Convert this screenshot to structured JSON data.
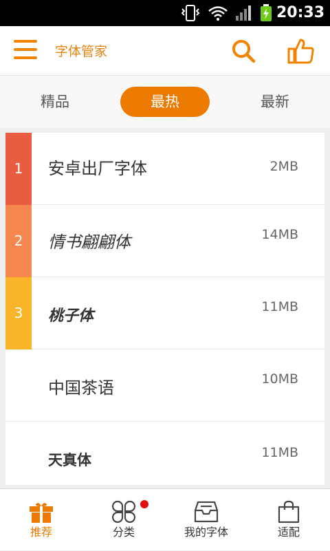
{
  "status_bar": {
    "time": "20:33",
    "icons": [
      "vibrate-icon",
      "wifi-icon",
      "signal-icon",
      "battery-charging-icon"
    ]
  },
  "header": {
    "title": "字体管家",
    "menu_icon": "menu-icon",
    "search_icon": "search-icon",
    "like_icon": "thumbs-up-icon"
  },
  "colors": {
    "accent": "#ec7a00",
    "rank1": "#e85c40",
    "rank2": "#f5874e",
    "rank3": "#f8b52a"
  },
  "tabs": [
    {
      "label": "精品"
    },
    {
      "label": "最热"
    },
    {
      "label": "最新"
    }
  ],
  "active_tab": "最热",
  "fonts": [
    {
      "rank": "1",
      "name": "安卓出厂字体",
      "size": "2MB"
    },
    {
      "rank": "2",
      "name": "情书翩翩体",
      "size": "14MB"
    },
    {
      "rank": "3",
      "name": "桃子体",
      "size": "11MB"
    },
    {
      "rank": "",
      "name": "中国茶语",
      "size": "10MB"
    },
    {
      "rank": "",
      "name": "天真体",
      "size": "11MB"
    }
  ],
  "bottom_nav": [
    {
      "label": "推荐",
      "icon": "gift-icon"
    },
    {
      "label": "分类",
      "icon": "category-icon"
    },
    {
      "label": "我的字体",
      "icon": "inbox-icon"
    },
    {
      "label": "适配",
      "icon": "shopping-bag-icon"
    }
  ]
}
